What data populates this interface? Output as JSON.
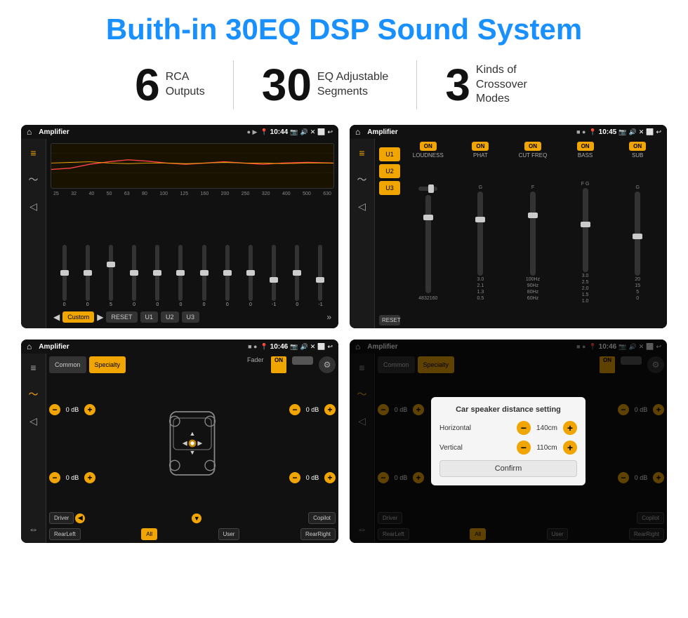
{
  "header": {
    "title": "Buith-in 30EQ DSP Sound System"
  },
  "stats": [
    {
      "number": "6",
      "label": "RCA\nOutputs"
    },
    {
      "number": "30",
      "label": "EQ Adjustable\nSegments"
    },
    {
      "number": "3",
      "label": "Kinds of\nCrossover Modes"
    }
  ],
  "screens": [
    {
      "id": "eq-screen",
      "statusBar": {
        "appTitle": "Amplifier",
        "time": "10:44"
      },
      "freqLabels": [
        "25",
        "32",
        "40",
        "50",
        "63",
        "80",
        "100",
        "125",
        "160",
        "200",
        "250",
        "320",
        "400",
        "500",
        "630"
      ],
      "sliderValues": [
        "0",
        "0",
        "0",
        "5",
        "0",
        "0",
        "0",
        "0",
        "0",
        "0",
        "-1",
        "0",
        "-1"
      ],
      "bottomButtons": [
        "Custom",
        "RESET",
        "U1",
        "U2",
        "U3"
      ]
    },
    {
      "id": "crossover-screen",
      "statusBar": {
        "appTitle": "Amplifier",
        "time": "10:45"
      },
      "uButtons": [
        "U1",
        "U2",
        "U3"
      ],
      "channels": [
        {
          "onLabel": "ON",
          "name": "LOUDNESS"
        },
        {
          "onLabel": "ON",
          "name": "PHAT"
        },
        {
          "onLabel": "ON",
          "name": "CUT FREQ"
        },
        {
          "onLabel": "ON",
          "name": "BASS"
        },
        {
          "onLabel": "ON",
          "name": "SUB"
        }
      ]
    },
    {
      "id": "fader-screen",
      "statusBar": {
        "appTitle": "Amplifier",
        "time": "10:46"
      },
      "tabs": [
        "Common",
        "Specialty"
      ],
      "faderLabel": "Fader",
      "onBadge": "ON",
      "dbControls": [
        {
          "value": "0 dB"
        },
        {
          "value": "0 dB"
        },
        {
          "value": "0 dB"
        },
        {
          "value": "0 dB"
        }
      ],
      "bottomButtons": [
        "Driver",
        "",
        "Copilot",
        "RearLeft",
        "All",
        "User",
        "RearRight"
      ]
    },
    {
      "id": "fader-dialog-screen",
      "statusBar": {
        "appTitle": "Amplifier",
        "time": "10:46"
      },
      "tabs": [
        "Common",
        "Specialty"
      ],
      "onBadge": "ON",
      "dialog": {
        "title": "Car speaker distance setting",
        "rows": [
          {
            "label": "Horizontal",
            "value": "140cm"
          },
          {
            "label": "Vertical",
            "value": "110cm"
          }
        ],
        "confirmLabel": "Confirm"
      },
      "dbControls": [
        {
          "value": "0 dB"
        },
        {
          "value": "0 dB"
        }
      ],
      "bottomButtons": [
        "Driver",
        "Copilot",
        "RearLeft",
        "All",
        "User",
        "RearRight"
      ]
    }
  ]
}
